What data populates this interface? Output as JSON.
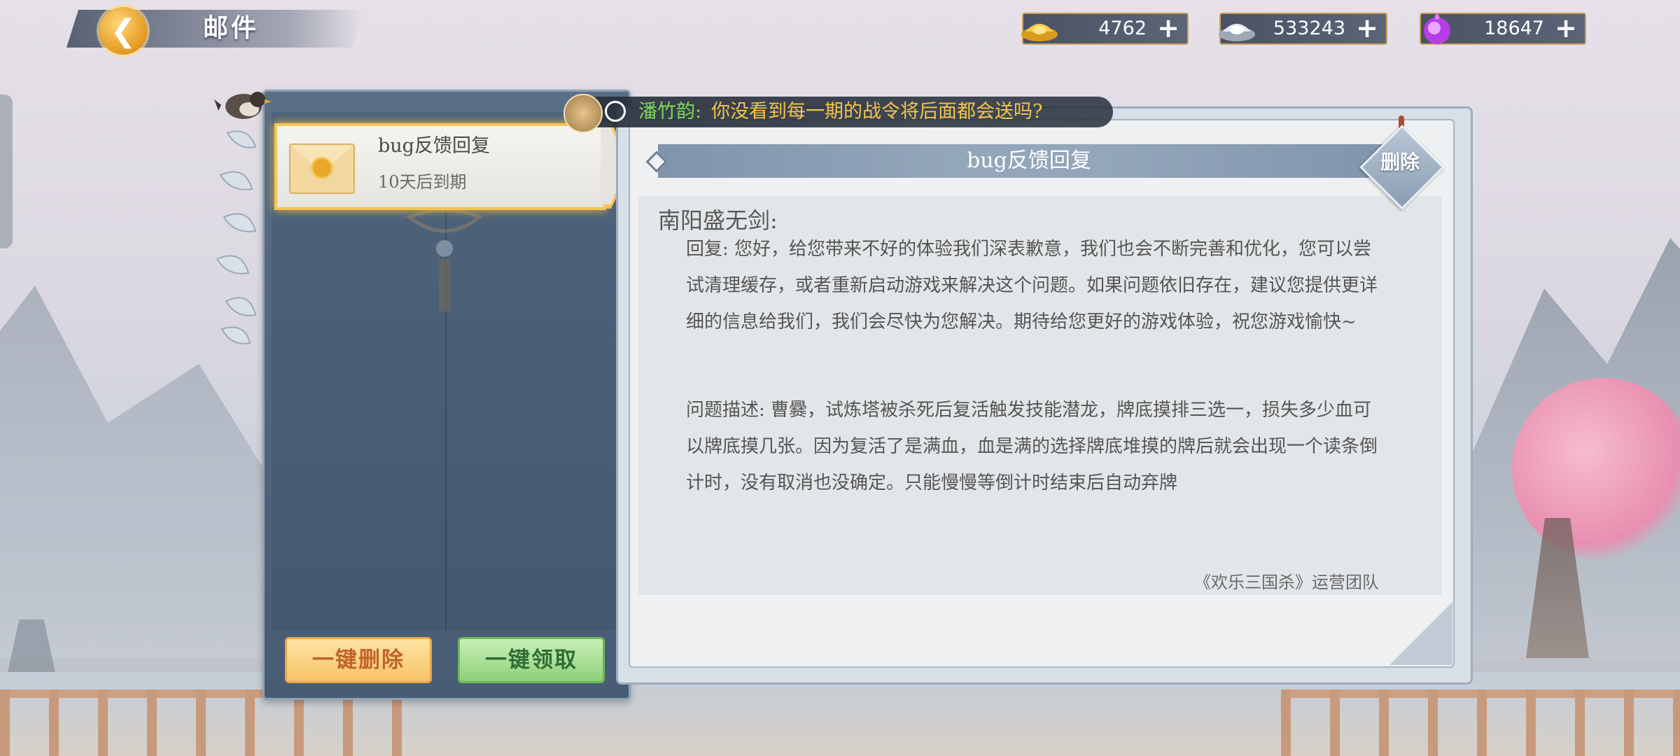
{
  "header": {
    "title": "邮件",
    "back_icon": "back-arrow-icon"
  },
  "currencies": [
    {
      "icon": "gold-ingot-icon",
      "value": "4762"
    },
    {
      "icon": "silver-ingot-icon",
      "value": "533243"
    },
    {
      "icon": "purple-orb-icon",
      "value": "18647"
    }
  ],
  "ticker": {
    "name": "潘竹韵:",
    "message": "你没看到每一期的战令将后面都会送吗?"
  },
  "mail_list": {
    "items": [
      {
        "title": "bug反馈回复",
        "expire": "10天后到期",
        "icon": "envelope-icon"
      }
    ],
    "delete_all_label": "一键删除",
    "claim_all_label": "一键领取"
  },
  "mail_detail": {
    "title": "bug反馈回复",
    "delete_label": "删除",
    "greeting": "南阳盛无剑:",
    "reply_text": "回复: 您好，给您带来不好的体验我们深表歉意，我们也会不断完善和优化，您可以尝试清理缓存，或者重新启动游戏来解决这个问题。如果问题依旧存在，建议您提供更详细的信息给我们，我们会尽快为您解决。期待给您更好的游戏体验，祝您游戏愉快~",
    "description_text": "问题描述: 曹爨，试炼塔被杀死后复活触发技能潜龙，牌底摸排三选一，损失多少血可以牌底摸几张。因为复活了是满血，血是满的选择牌底堆摸的牌后就会出现一个读条倒计时，没有取消也没确定。只能慢慢等倒计时结束后自动弃牌",
    "signature": "《欢乐三国杀》运营团队"
  },
  "colors": {
    "highlight": "#f6c454",
    "panel": "#4f647c",
    "ticker_name": "#7ed957",
    "ticker_msg": "#f2c44d"
  }
}
